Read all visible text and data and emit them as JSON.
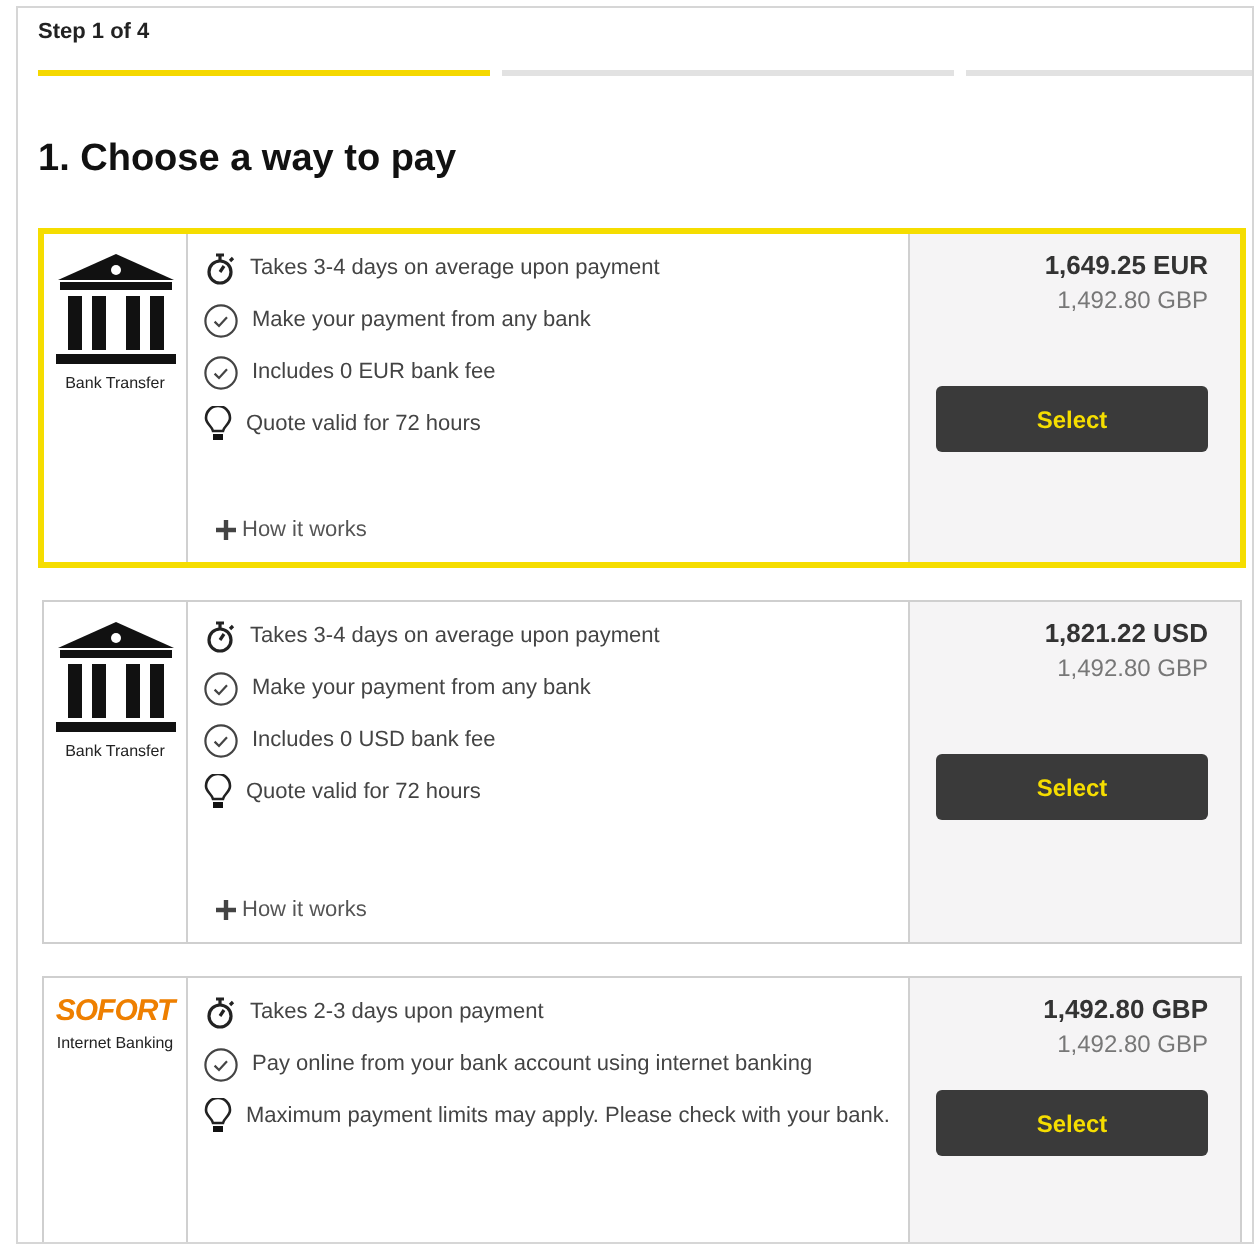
{
  "step_label": "Step 1 of 4",
  "progress": [
    {
      "selected": true
    },
    {
      "selected": false
    },
    {
      "selected": false
    }
  ],
  "heading": "1. Choose a way to pay",
  "options": [
    {
      "kind": "bank",
      "selected": true,
      "method": "Bank Transfer",
      "features": [
        {
          "kind": "timer",
          "text": "Takes 3-4 days on average upon payment"
        },
        {
          "kind": "check",
          "text": "Make your payment from any bank"
        },
        {
          "kind": "check",
          "text": "Includes 0 EUR bank fee"
        },
        {
          "kind": "bulb",
          "text": "Quote valid for 72 hours"
        }
      ],
      "link": "How it works",
      "price": "1,649.25 EUR",
      "converted": "1,492.80 GBP",
      "button": "Select"
    },
    {
      "kind": "bank",
      "selected": false,
      "method": "Bank Transfer",
      "features": [
        {
          "kind": "timer",
          "text": "Takes 3-4 days on average upon payment"
        },
        {
          "kind": "check",
          "text": "Make your payment from any bank"
        },
        {
          "kind": "check",
          "text": "Includes 0 USD bank fee"
        },
        {
          "kind": "bulb",
          "text": "Quote valid for 72 hours"
        }
      ],
      "link": "How it works",
      "price": "1,821.22 USD",
      "converted": "1,492.80 GBP",
      "button": "Select"
    },
    {
      "kind": "sofort",
      "selected": false,
      "logo_text": "SOFORT",
      "method": "Internet Banking",
      "features": [
        {
          "kind": "timer",
          "text": "Takes 2-3 days upon payment"
        },
        {
          "kind": "check",
          "text": "Pay online from your bank account using internet banking"
        },
        {
          "kind": "bulb",
          "text": "Maximum payment limits may apply. Please check with your bank."
        }
      ],
      "price": "1,492.80 GBP",
      "converted": "1,492.80 GBP",
      "button": "Select"
    }
  ]
}
